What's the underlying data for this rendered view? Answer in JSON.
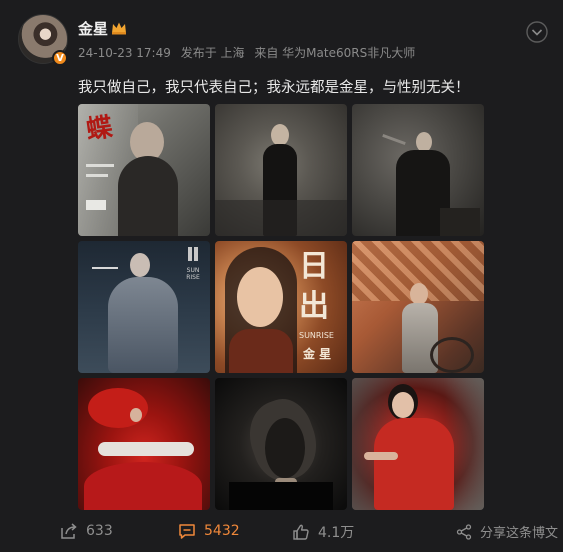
{
  "post": {
    "username": "金星",
    "verified_badge": "V",
    "meta": {
      "date": "24-10-23 17:49",
      "published_from": "发布于 上海",
      "device": "来自 华为Mate60RS非凡大师"
    },
    "text": "我只做自己，我只代表自己；我永远都是金星，与性别无关！"
  },
  "images": [
    {
      "name": "photo-1-cover",
      "theme": "grey"
    },
    {
      "name": "photo-2",
      "theme": "grey"
    },
    {
      "name": "photo-3",
      "theme": "grey"
    },
    {
      "name": "photo-4",
      "theme": "blue-grey"
    },
    {
      "name": "photo-5-sunrise-poster",
      "theme": "orange"
    },
    {
      "name": "photo-6",
      "theme": "orange"
    },
    {
      "name": "photo-7",
      "theme": "red"
    },
    {
      "name": "photo-8",
      "theme": "black"
    },
    {
      "name": "photo-9",
      "theme": "red"
    }
  ],
  "posters": {
    "sunrise_big_title": "日出",
    "sunrise_en": "SUNRISE",
    "sunrise_name": "金 星",
    "sun_rise_side": "SUN RISE"
  },
  "actions": {
    "share_count": "633",
    "comment_count": "5432",
    "like_count": "4.1万",
    "share_label": "分享这条博文"
  },
  "colors": {
    "background": "#1c1c1e",
    "accent_orange": "#f0883a",
    "muted_text": "#8a8a8a"
  }
}
